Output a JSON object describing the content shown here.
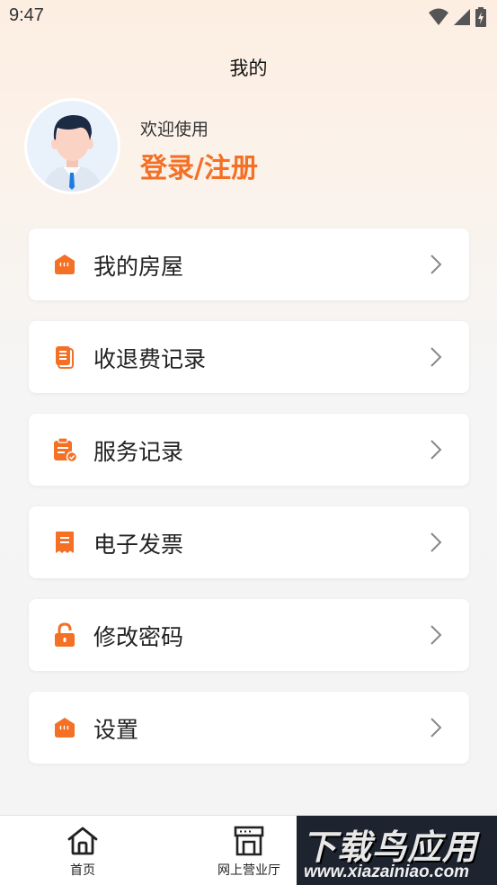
{
  "status_bar": {
    "time": "9:47"
  },
  "header": {
    "title": "我的"
  },
  "profile": {
    "welcome": "欢迎使用",
    "login_label": "登录/注册"
  },
  "menu": {
    "items": [
      {
        "label": "我的房屋",
        "icon": "house-icon"
      },
      {
        "label": "收退费记录",
        "icon": "document-icon"
      },
      {
        "label": "服务记录",
        "icon": "clipboard-check-icon"
      },
      {
        "label": "电子发票",
        "icon": "invoice-icon"
      },
      {
        "label": "修改密码",
        "icon": "lock-icon"
      },
      {
        "label": "设置",
        "icon": "house-icon"
      }
    ]
  },
  "bottom_nav": {
    "items": [
      {
        "label": "首页",
        "icon": "home-icon"
      },
      {
        "label": "网上营业厅",
        "icon": "storefront-icon"
      }
    ]
  },
  "watermark": {
    "title": "下载鸟应用",
    "url": "www.xiazainiao.com"
  },
  "colors": {
    "accent": "#f37025",
    "card": "#ffffff",
    "background": "#f4f4f4"
  }
}
